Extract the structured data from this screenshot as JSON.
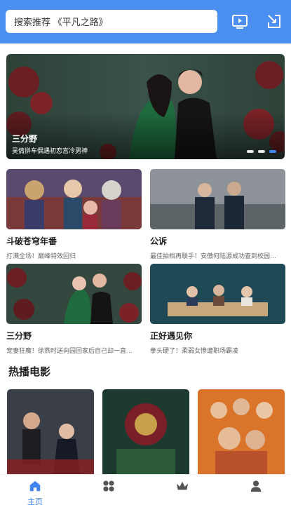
{
  "search": {
    "text": "搜索推荐 《平凡之路》"
  },
  "header_icons": [
    "tv-play-icon",
    "share-icon"
  ],
  "banner": {
    "title": "三分野",
    "subtitle": "吴倩拼车偶遇初恋宫冷男神",
    "dots": 3,
    "active_dot": 3
  },
  "cards": [
    {
      "title": "斗破苍穹年番",
      "desc": "打满全场！巅峰特效回归"
    },
    {
      "title": "公诉",
      "desc": "最佳拍档再联手！安傲何陆源成功查到校园…"
    },
    {
      "title": "三分野",
      "desc": "宠妻狂魔！徐燕时送向园回家后自己却一直…"
    },
    {
      "title": "正好遇见你",
      "desc": "拳头硬了！柔弱女惨遭职场霸凌"
    }
  ],
  "section": {
    "title": "热播电影"
  },
  "tabs": [
    {
      "label": "主页",
      "icon": "home-icon",
      "active": true
    },
    {
      "label": "",
      "icon": "category-icon",
      "active": false
    },
    {
      "label": "",
      "icon": "crown-icon",
      "active": false
    },
    {
      "label": "",
      "icon": "user-icon",
      "active": false
    }
  ],
  "colors": {
    "accent": "#4b8ff0",
    "active_tab": "#3f84ef",
    "inactive_tab": "#555555"
  }
}
